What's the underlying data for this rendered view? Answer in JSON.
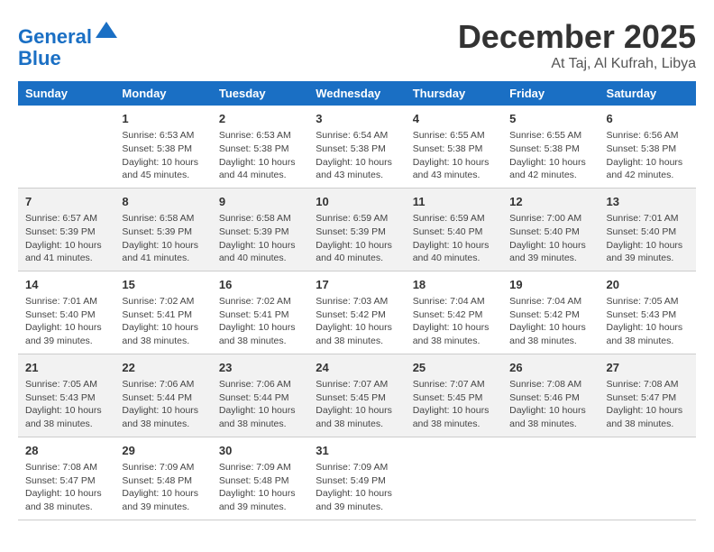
{
  "logo": {
    "line1": "General",
    "line2": "Blue"
  },
  "title": "December 2025",
  "location": "At Taj, Al Kufrah, Libya",
  "days_of_week": [
    "Sunday",
    "Monday",
    "Tuesday",
    "Wednesday",
    "Thursday",
    "Friday",
    "Saturday"
  ],
  "weeks": [
    [
      {
        "num": "",
        "info": ""
      },
      {
        "num": "1",
        "info": "Sunrise: 6:53 AM\nSunset: 5:38 PM\nDaylight: 10 hours\nand 45 minutes."
      },
      {
        "num": "2",
        "info": "Sunrise: 6:53 AM\nSunset: 5:38 PM\nDaylight: 10 hours\nand 44 minutes."
      },
      {
        "num": "3",
        "info": "Sunrise: 6:54 AM\nSunset: 5:38 PM\nDaylight: 10 hours\nand 43 minutes."
      },
      {
        "num": "4",
        "info": "Sunrise: 6:55 AM\nSunset: 5:38 PM\nDaylight: 10 hours\nand 43 minutes."
      },
      {
        "num": "5",
        "info": "Sunrise: 6:55 AM\nSunset: 5:38 PM\nDaylight: 10 hours\nand 42 minutes."
      },
      {
        "num": "6",
        "info": "Sunrise: 6:56 AM\nSunset: 5:38 PM\nDaylight: 10 hours\nand 42 minutes."
      }
    ],
    [
      {
        "num": "7",
        "info": "Sunrise: 6:57 AM\nSunset: 5:39 PM\nDaylight: 10 hours\nand 41 minutes."
      },
      {
        "num": "8",
        "info": "Sunrise: 6:58 AM\nSunset: 5:39 PM\nDaylight: 10 hours\nand 41 minutes."
      },
      {
        "num": "9",
        "info": "Sunrise: 6:58 AM\nSunset: 5:39 PM\nDaylight: 10 hours\nand 40 minutes."
      },
      {
        "num": "10",
        "info": "Sunrise: 6:59 AM\nSunset: 5:39 PM\nDaylight: 10 hours\nand 40 minutes."
      },
      {
        "num": "11",
        "info": "Sunrise: 6:59 AM\nSunset: 5:40 PM\nDaylight: 10 hours\nand 40 minutes."
      },
      {
        "num": "12",
        "info": "Sunrise: 7:00 AM\nSunset: 5:40 PM\nDaylight: 10 hours\nand 39 minutes."
      },
      {
        "num": "13",
        "info": "Sunrise: 7:01 AM\nSunset: 5:40 PM\nDaylight: 10 hours\nand 39 minutes."
      }
    ],
    [
      {
        "num": "14",
        "info": "Sunrise: 7:01 AM\nSunset: 5:40 PM\nDaylight: 10 hours\nand 39 minutes."
      },
      {
        "num": "15",
        "info": "Sunrise: 7:02 AM\nSunset: 5:41 PM\nDaylight: 10 hours\nand 38 minutes."
      },
      {
        "num": "16",
        "info": "Sunrise: 7:02 AM\nSunset: 5:41 PM\nDaylight: 10 hours\nand 38 minutes."
      },
      {
        "num": "17",
        "info": "Sunrise: 7:03 AM\nSunset: 5:42 PM\nDaylight: 10 hours\nand 38 minutes."
      },
      {
        "num": "18",
        "info": "Sunrise: 7:04 AM\nSunset: 5:42 PM\nDaylight: 10 hours\nand 38 minutes."
      },
      {
        "num": "19",
        "info": "Sunrise: 7:04 AM\nSunset: 5:42 PM\nDaylight: 10 hours\nand 38 minutes."
      },
      {
        "num": "20",
        "info": "Sunrise: 7:05 AM\nSunset: 5:43 PM\nDaylight: 10 hours\nand 38 minutes."
      }
    ],
    [
      {
        "num": "21",
        "info": "Sunrise: 7:05 AM\nSunset: 5:43 PM\nDaylight: 10 hours\nand 38 minutes."
      },
      {
        "num": "22",
        "info": "Sunrise: 7:06 AM\nSunset: 5:44 PM\nDaylight: 10 hours\nand 38 minutes."
      },
      {
        "num": "23",
        "info": "Sunrise: 7:06 AM\nSunset: 5:44 PM\nDaylight: 10 hours\nand 38 minutes."
      },
      {
        "num": "24",
        "info": "Sunrise: 7:07 AM\nSunset: 5:45 PM\nDaylight: 10 hours\nand 38 minutes."
      },
      {
        "num": "25",
        "info": "Sunrise: 7:07 AM\nSunset: 5:45 PM\nDaylight: 10 hours\nand 38 minutes."
      },
      {
        "num": "26",
        "info": "Sunrise: 7:08 AM\nSunset: 5:46 PM\nDaylight: 10 hours\nand 38 minutes."
      },
      {
        "num": "27",
        "info": "Sunrise: 7:08 AM\nSunset: 5:47 PM\nDaylight: 10 hours\nand 38 minutes."
      }
    ],
    [
      {
        "num": "28",
        "info": "Sunrise: 7:08 AM\nSunset: 5:47 PM\nDaylight: 10 hours\nand 38 minutes."
      },
      {
        "num": "29",
        "info": "Sunrise: 7:09 AM\nSunset: 5:48 PM\nDaylight: 10 hours\nand 39 minutes."
      },
      {
        "num": "30",
        "info": "Sunrise: 7:09 AM\nSunset: 5:48 PM\nDaylight: 10 hours\nand 39 minutes."
      },
      {
        "num": "31",
        "info": "Sunrise: 7:09 AM\nSunset: 5:49 PM\nDaylight: 10 hours\nand 39 minutes."
      },
      {
        "num": "",
        "info": ""
      },
      {
        "num": "",
        "info": ""
      },
      {
        "num": "",
        "info": ""
      }
    ]
  ]
}
